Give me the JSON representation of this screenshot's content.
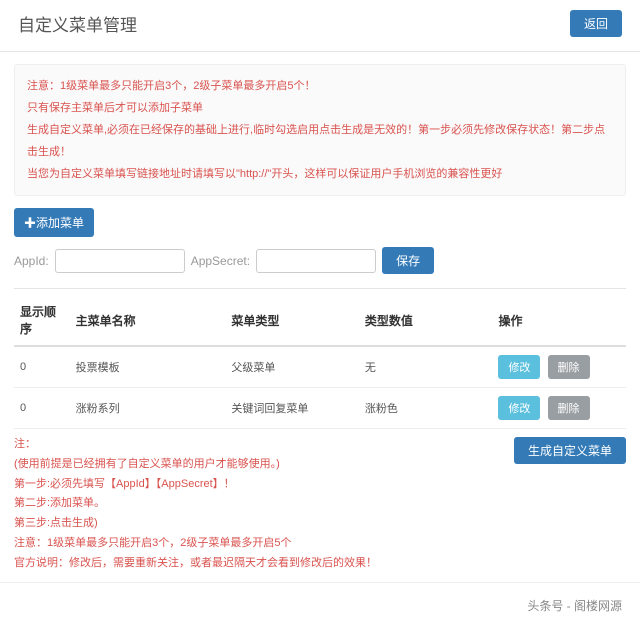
{
  "header": {
    "title": "自定义菜单管理",
    "back_label": "返回"
  },
  "notices": [
    "注意：1级菜单最多只能开启3个，2级子菜单最多开启5个！",
    "只有保存主菜单后才可以添加子菜单",
    "生成自定义菜单,必须在已经保存的基础上进行,临时勾选启用点击生成是无效的！第一步必须先修改保存状态！第二步点击生成！",
    "当您为自定义菜单填写链接地址时请填写以\"http://\"开头，这样可以保证用户手机浏览的兼容性更好"
  ],
  "add_button_label": "✚添加菜单",
  "form": {
    "appid_label": "AppId:",
    "appid_value": "",
    "appsecret_label": "AppSecret:",
    "appsecret_value": "",
    "save_label": "保存"
  },
  "table": {
    "headers": {
      "order": "显示顺序",
      "name": "主菜单名称",
      "type": "菜单类型",
      "value": "类型数值",
      "action": "操作"
    },
    "rows": [
      {
        "order": "0",
        "name": "投票模板",
        "type": "父级菜单",
        "value": "无"
      },
      {
        "order": "0",
        "name": "涨粉系列",
        "type": "关键词回复菜单",
        "value": "涨粉色"
      }
    ],
    "edit_label": "修改",
    "delete_label": "删除"
  },
  "footnotes": [
    "注：",
    "(使用前提是已经拥有了自定义菜单的用户才能够使用。)",
    "第一步:必须先填写【AppId】【AppSecret】！",
    "第二步:添加菜单。",
    "第三步:点击生成)",
    "注意：1级菜单最多只能开启3个，2级子菜单最多开启5个",
    "官方说明：修改后，需要重新关注，或者最迟隔天才会看到修改后的效果！"
  ],
  "generate_label": "生成自定义菜单",
  "footer": "头条号 - 阁楼网源"
}
